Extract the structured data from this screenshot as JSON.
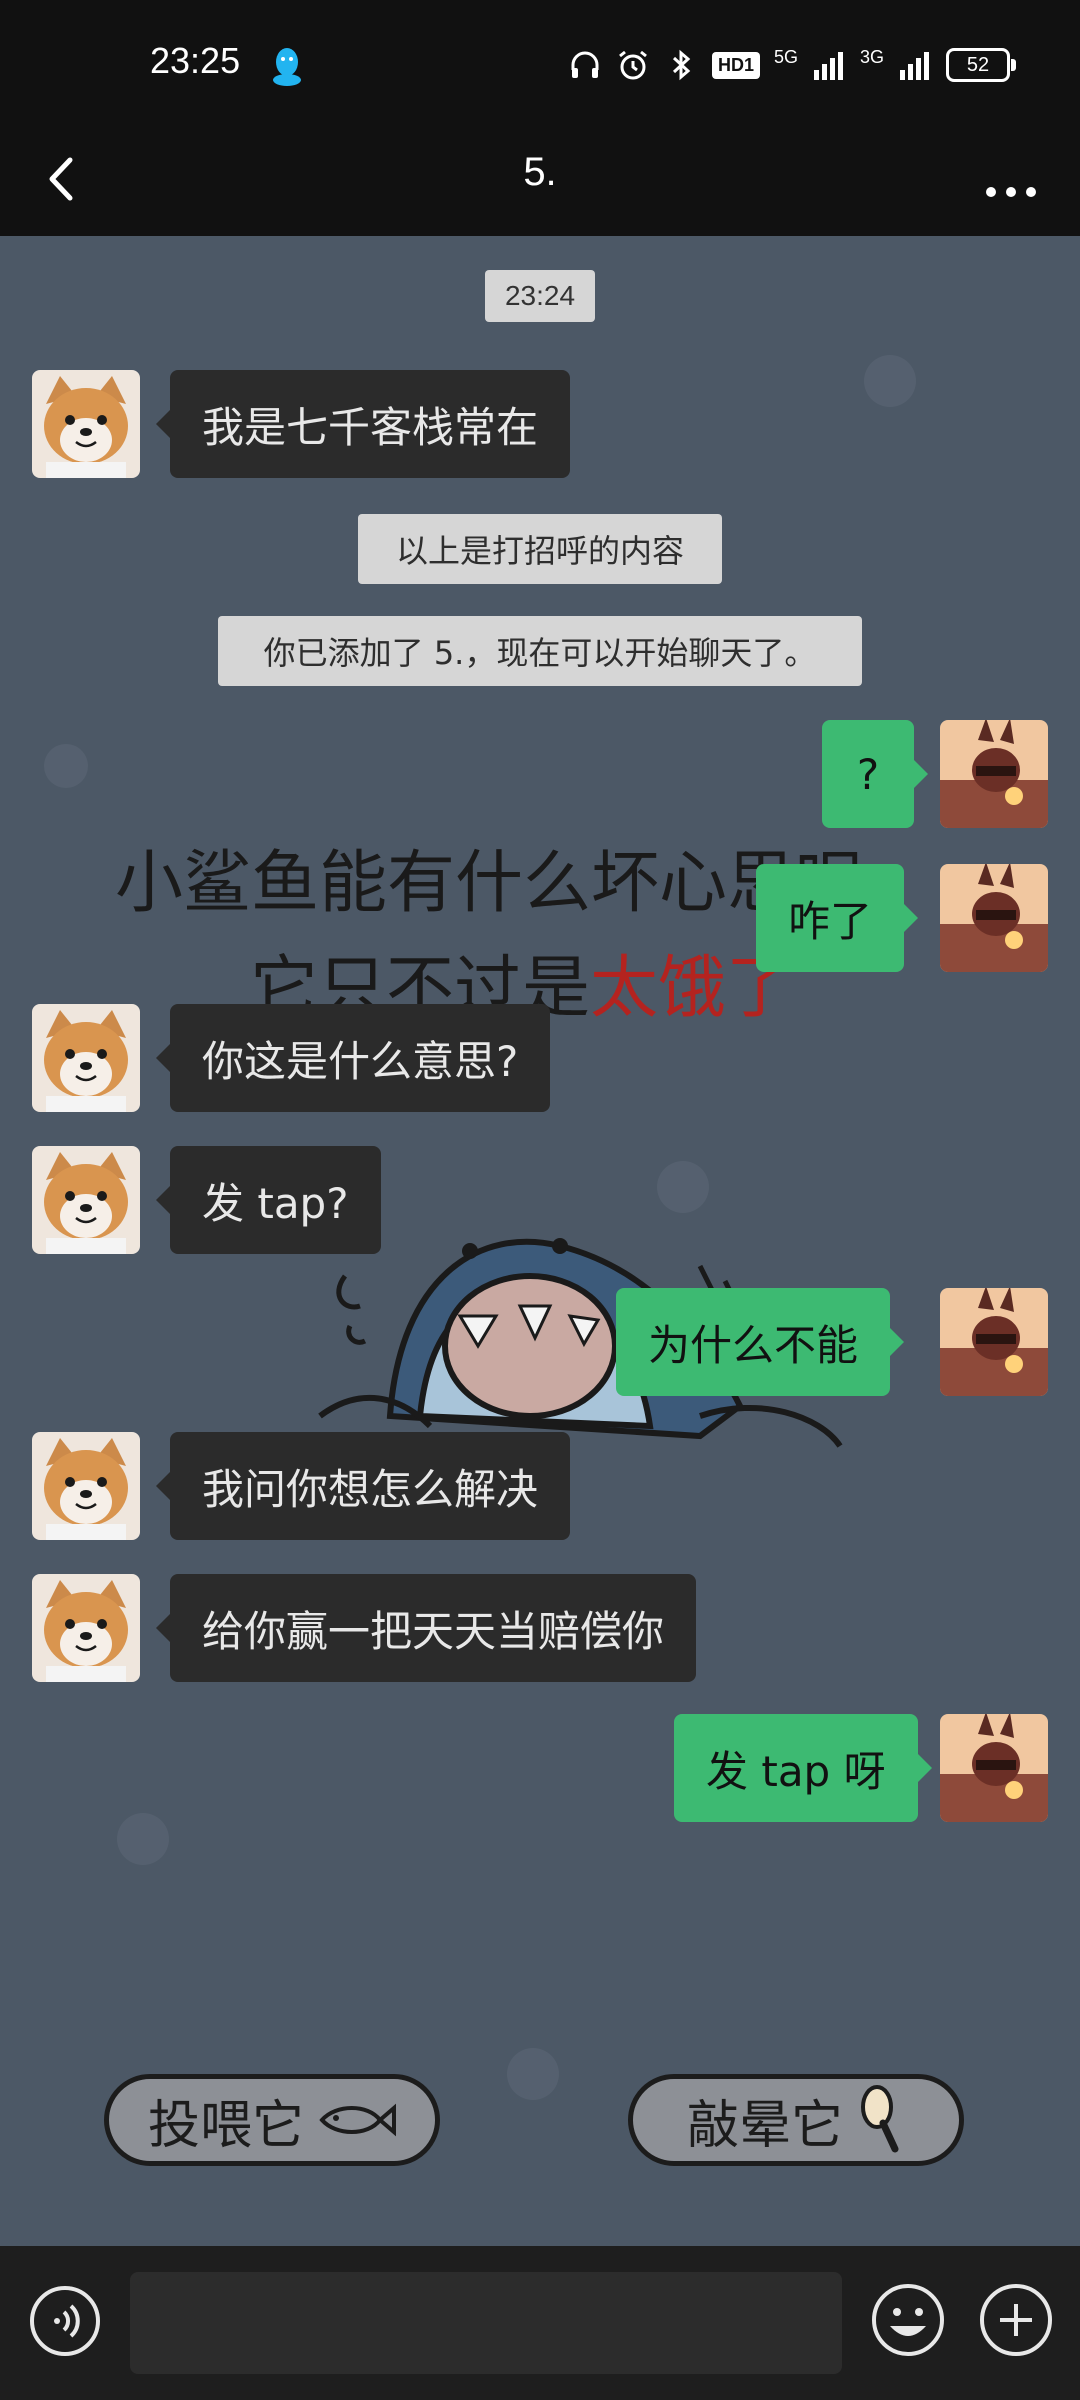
{
  "status_bar": {
    "time": "23:25",
    "hd": "HD1",
    "net1": "5G",
    "net2": "3G",
    "battery": "52"
  },
  "header": {
    "title": "5."
  },
  "chat": {
    "timestamp": "23:24",
    "system_notes": {
      "greeting_note": "以上是打招呼的内容",
      "added_note": "你已添加了 5.，现在可以开始聊天了。"
    },
    "messages": [
      {
        "side": "in",
        "text": "我是七千客栈常在"
      },
      {
        "side": "out",
        "text": "?"
      },
      {
        "side": "out",
        "text": "咋了"
      },
      {
        "side": "in",
        "text": "你这是什么意思?"
      },
      {
        "side": "in",
        "text": "发 tap?"
      },
      {
        "side": "out",
        "text": "为什么不能"
      },
      {
        "side": "in",
        "text": "我问你想怎么解决"
      },
      {
        "side": "in",
        "text": "给你赢一把天天当赔偿你"
      },
      {
        "side": "out",
        "text": "发 tap 呀"
      }
    ],
    "wallpaper": {
      "line1": "小鲨鱼能有什么坏心思呢",
      "line2_a": "它只不过是",
      "line2_b": "太饿了",
      "button_feed": "投喂它",
      "button_knock": "敲晕它"
    }
  },
  "input_bar": {
    "message_value": "",
    "voice_icon": "voice-icon",
    "emoji_icon": "emoji-icon",
    "plus_icon": "plus-icon"
  },
  "colors": {
    "chat_background": "#4c5866",
    "incoming_bubble": "#2b2b2b",
    "outgoing_bubble": "#3dba72",
    "system_chip": "#d6d6d6",
    "bar": "#111111"
  }
}
